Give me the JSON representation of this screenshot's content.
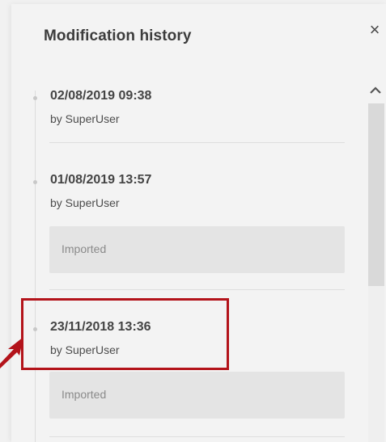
{
  "panel": {
    "title": "Modification history",
    "close_symbol": "×"
  },
  "entries": [
    {
      "date": "02/08/2019 09:38",
      "author": "by SuperUser",
      "comment": ""
    },
    {
      "date": "01/08/2019 13:57",
      "author": "by SuperUser",
      "comment": "Imported"
    },
    {
      "date": "23/11/2018 13:36",
      "author": "by SuperUser",
      "comment": "Imported"
    }
  ],
  "icons": {
    "close": "close-icon",
    "scroll_up": "chevron-up-icon",
    "annotation_arrow": "arrow-icon"
  },
  "colors": {
    "highlight": "#b3131a",
    "background": "#f3f3f3",
    "comment_bg": "#e4e4e4"
  }
}
